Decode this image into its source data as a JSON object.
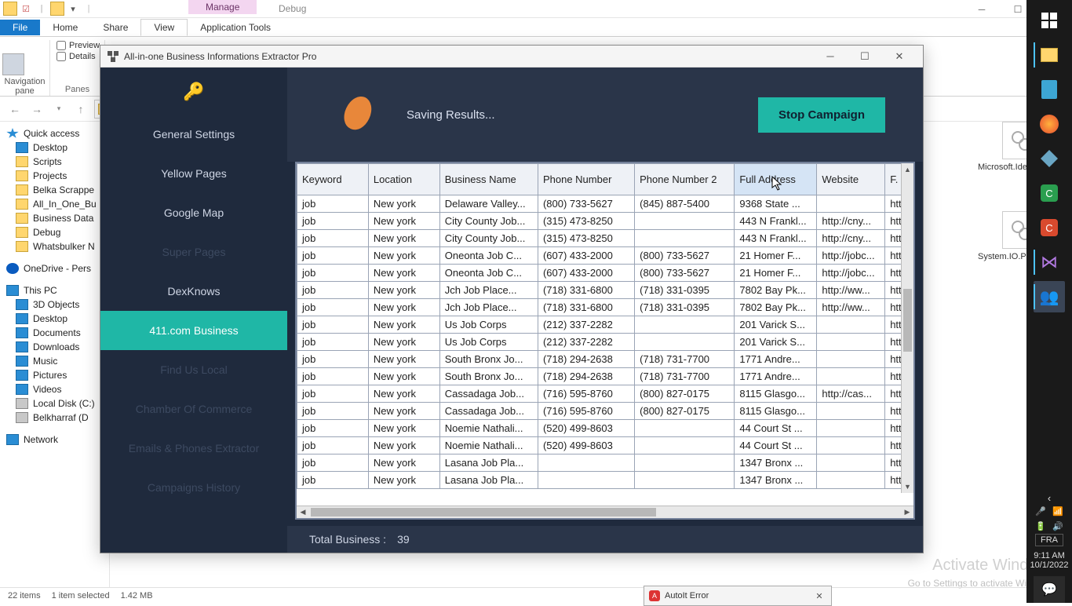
{
  "explorer": {
    "title_tabs": {
      "manage": "Manage",
      "debug": "Debug"
    },
    "ribbon_tabs": {
      "file": "File",
      "home": "Home",
      "share": "Share",
      "view": "View",
      "apptools": "Application Tools"
    },
    "ribbon": {
      "navpane": "Navigation pane",
      "preview": "Preview",
      "details": "Details",
      "panes": "Panes"
    },
    "nav": {
      "back": "←",
      "fwd": "→",
      "up": "↑"
    },
    "tree": {
      "quick": "Quick access",
      "desktop": "Desktop",
      "scripts": "Scripts",
      "projects": "Projects",
      "belka": "Belka Scrappe",
      "allinone": "All_In_One_Bu",
      "bizdata": "Business Data",
      "debug": "Debug",
      "whats": "Whatsbulker N",
      "onedrive": "OneDrive - Pers",
      "thispc": "This PC",
      "obj3d": "3D Objects",
      "desktop2": "Desktop",
      "documents": "Documents",
      "downloads": "Downloads",
      "music": "Music",
      "pictures": "Pictures",
      "videos": "Videos",
      "localc": "Local Disk (C:)",
      "belkh": "Belkharraf (D",
      "network": "Network"
    },
    "files": {
      "f1": "Microsoft.IdentityModel.Tokens.dll",
      "f2": "System.IO.Packaging.dll"
    },
    "watermark": "Activate Windows",
    "watermark2": "Go to Settings to activate Windows.",
    "status": {
      "items": "22 items",
      "selected": "1 item selected",
      "size": "1.42 MB"
    }
  },
  "app": {
    "title": "All-in-one Business Informations Extractor Pro",
    "sidebar": [
      {
        "label": "General Settings",
        "dim": false
      },
      {
        "label": "Yellow Pages",
        "dim": false
      },
      {
        "label": "Google Map",
        "dim": false
      },
      {
        "label": "Super Pages",
        "dim": true
      },
      {
        "label": "DexKnows",
        "dim": false
      },
      {
        "label": "411.com Business",
        "dim": false,
        "active": true
      },
      {
        "label": "Find Us Local",
        "dim": true
      },
      {
        "label": "Chamber Of Commerce",
        "dim": true
      },
      {
        "label": "Emails & Phones Extractor",
        "dim": true
      },
      {
        "label": "Campaigns History",
        "dim": true
      }
    ],
    "status_text": "Saving Results...",
    "stop_label": "Stop Campaign",
    "columns": [
      "Keyword",
      "Location",
      "Business Name",
      "Phone Number",
      "Phone Number 2",
      "Full Address",
      "Website",
      "F. P"
    ],
    "rows": [
      {
        "kw": "job",
        "lo": "New york",
        "bn": "Delaware Valley...",
        "p1": "(800) 733-5627",
        "p2": "(845) 887-5400",
        "fa": "9368 State ...",
        "ws": "",
        "fp": "htt"
      },
      {
        "kw": "job",
        "lo": "New york",
        "bn": "City County Job...",
        "p1": "(315) 473-8250",
        "p2": "",
        "fa": "443 N Frankl...",
        "ws": "http://cny...",
        "fp": "htt"
      },
      {
        "kw": "job",
        "lo": "New york",
        "bn": "City County Job...",
        "p1": "(315) 473-8250",
        "p2": "",
        "fa": "443 N Frankl...",
        "ws": "http://cny...",
        "fp": "htt"
      },
      {
        "kw": "job",
        "lo": "New york",
        "bn": "Oneonta Job C...",
        "p1": "(607) 433-2000",
        "p2": "(800) 733-5627",
        "fa": "21 Homer F...",
        "ws": "http://jobc...",
        "fp": "htt"
      },
      {
        "kw": "job",
        "lo": "New york",
        "bn": "Oneonta Job C...",
        "p1": "(607) 433-2000",
        "p2": "(800) 733-5627",
        "fa": "21 Homer F...",
        "ws": "http://jobc...",
        "fp": "htt"
      },
      {
        "kw": "job",
        "lo": "New york",
        "bn": "Jch Job Place...",
        "p1": "(718) 331-6800",
        "p2": "(718) 331-0395",
        "fa": "7802 Bay Pk...",
        "ws": "http://ww...",
        "fp": "htt"
      },
      {
        "kw": "job",
        "lo": "New york",
        "bn": "Jch Job Place...",
        "p1": "(718) 331-6800",
        "p2": "(718) 331-0395",
        "fa": "7802 Bay Pk...",
        "ws": "http://ww...",
        "fp": "htt"
      },
      {
        "kw": "job",
        "lo": "New york",
        "bn": "Us Job Corps",
        "p1": "(212) 337-2282",
        "p2": "",
        "fa": "201 Varick S...",
        "ws": "",
        "fp": "htt"
      },
      {
        "kw": "job",
        "lo": "New york",
        "bn": "Us Job Corps",
        "p1": "(212) 337-2282",
        "p2": "",
        "fa": "201 Varick S...",
        "ws": "",
        "fp": "htt"
      },
      {
        "kw": "job",
        "lo": "New york",
        "bn": "South Bronx Jo...",
        "p1": "(718) 294-2638",
        "p2": "(718) 731-7700",
        "fa": "1771 Andre...",
        "ws": "",
        "fp": "htt"
      },
      {
        "kw": "job",
        "lo": "New york",
        "bn": "South Bronx Jo...",
        "p1": "(718) 294-2638",
        "p2": "(718) 731-7700",
        "fa": "1771 Andre...",
        "ws": "",
        "fp": "htt"
      },
      {
        "kw": "job",
        "lo": "New york",
        "bn": "Cassadaga Job...",
        "p1": "(716) 595-8760",
        "p2": "(800) 827-0175",
        "fa": "8115 Glasgo...",
        "ws": "http://cas...",
        "fp": "htt"
      },
      {
        "kw": "job",
        "lo": "New york",
        "bn": "Cassadaga Job...",
        "p1": "(716) 595-8760",
        "p2": "(800) 827-0175",
        "fa": "8115 Glasgo...",
        "ws": "",
        "fp": "htt"
      },
      {
        "kw": "job",
        "lo": "New york",
        "bn": "Noemie Nathali...",
        "p1": "(520) 499-8603",
        "p2": "",
        "fa": "44 Court St ...",
        "ws": "",
        "fp": "htt"
      },
      {
        "kw": "job",
        "lo": "New york",
        "bn": "Noemie Nathali...",
        "p1": "(520) 499-8603",
        "p2": "",
        "fa": "44 Court St ...",
        "ws": "",
        "fp": "htt"
      },
      {
        "kw": "job",
        "lo": "New york",
        "bn": "Lasana Job Pla...",
        "p1": "",
        "p2": "",
        "fa": "1347 Bronx ...",
        "ws": "",
        "fp": "htt"
      },
      {
        "kw": "job",
        "lo": "New york",
        "bn": "Lasana Job Pla...",
        "p1": "",
        "p2": "",
        "fa": "1347 Bronx ...",
        "ws": "",
        "fp": "htt"
      }
    ],
    "footer_label": "Total Business :",
    "footer_count": "39"
  },
  "autoit": {
    "title": "AutoIt Error"
  },
  "taskbar": {
    "lang": "FRA",
    "time": "9:11 AM",
    "date": "10/1/2022"
  }
}
